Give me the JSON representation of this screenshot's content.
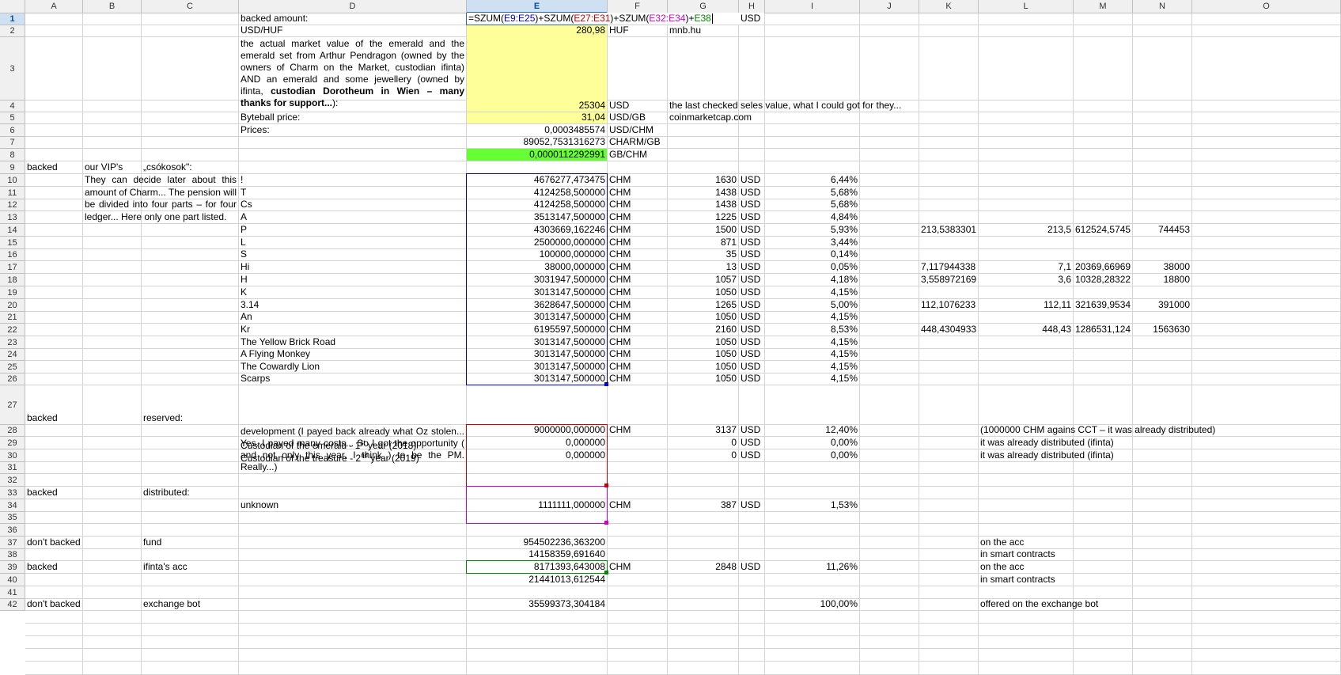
{
  "sheet": {
    "columns": [
      "A",
      "B",
      "C",
      "D",
      "E",
      "F",
      "G",
      "H",
      "I",
      "J",
      "K",
      "L",
      "M",
      "N",
      "O"
    ],
    "selected_column": "E",
    "selected_row": "1",
    "rows": [
      "1",
      "2",
      "3",
      "4",
      "5",
      "6",
      "7",
      "8",
      "9",
      "10",
      "11",
      "12",
      "13",
      "14",
      "15",
      "16",
      "17",
      "18",
      "19",
      "20",
      "21",
      "22",
      "23",
      "24",
      "25",
      "26",
      "27",
      "28",
      "29",
      "30",
      "31",
      "32",
      "33",
      "34",
      "35",
      "36",
      "37",
      "38",
      "39",
      "40",
      "41",
      "42"
    ]
  },
  "formula": {
    "p1": "=SZUM(",
    "r1": "E9:E25",
    "p2": ")+SZUM(",
    "r2": "E27:E31",
    "p3": ")+SZUM(",
    "r3": "E32:E34",
    "p4": ")+",
    "r4": "E38"
  },
  "top": {
    "backed_amount": "backed amount:",
    "usd": "USD",
    "usdhuf_label": "USD/HUF",
    "usdhuf_value": "280,98",
    "huf": "HUF",
    "mnb": "mnb.hu",
    "desc_plain": "the actual market value of the emerald and the emerald set from Arthur Pendragon (owned by the owners of Charm on the Market, custodian ifinta) AND an emerald and some jewellery (owned by ifinta, ",
    "desc_bold": "custodian Dorotheum in Wien – many thanks for support...",
    "desc_end": "):",
    "market_value": "25304",
    "market_unit": "USD",
    "seles_note": "the last checked seles value, what I could got for they...",
    "byteball_label": "Byteball price:",
    "byteball_value": "31,04",
    "byteball_unit": "USD/GB",
    "cmc": "coinmarketcap.com",
    "prices_label": "Prices:",
    "price1": "0,0003485574",
    "price1_unit": "USD/CHM",
    "price2": "89052,7531316273",
    "price2_unit": "CHARM/GB",
    "price3": "0,0000112292991",
    "price3_unit": "GB/CHM"
  },
  "r8": {
    "a": "backed",
    "b": "our VIP's",
    "c": "„csókosok\":"
  },
  "vip_note": "They can decide later about this amount of Charm... The pension will be divided into four parts – for four ledger... Here only one part listed.",
  "vip": [
    {
      "name": "!",
      "chm": "4676277,473475",
      "unit": "CHM",
      "usd": "1630",
      "cur": "USD",
      "pct": "6,44%",
      "k": "",
      "l": "",
      "m": "",
      "n": ""
    },
    {
      "name": "T",
      "chm": "4124258,500000",
      "unit": "CHM",
      "usd": "1438",
      "cur": "USD",
      "pct": "5,68%",
      "k": "",
      "l": "",
      "m": "",
      "n": ""
    },
    {
      "name": "Cs",
      "chm": "4124258,500000",
      "unit": "CHM",
      "usd": "1438",
      "cur": "USD",
      "pct": "5,68%",
      "k": "",
      "l": "",
      "m": "",
      "n": ""
    },
    {
      "name": "A",
      "chm": "3513147,500000",
      "unit": "CHM",
      "usd": "1225",
      "cur": "USD",
      "pct": "4,84%",
      "k": "",
      "l": "",
      "m": "",
      "n": ""
    },
    {
      "name": "P",
      "chm": "4303669,162246",
      "unit": "CHM",
      "usd": "1500",
      "cur": "USD",
      "pct": "5,93%",
      "k": "213,5383301",
      "l": "213,5",
      "m": "612524,5745",
      "n": "744453"
    },
    {
      "name": "L",
      "chm": "2500000,000000",
      "unit": "CHM",
      "usd": "871",
      "cur": "USD",
      "pct": "3,44%",
      "k": "",
      "l": "",
      "m": "",
      "n": ""
    },
    {
      "name": "S",
      "chm": "100000,000000",
      "unit": "CHM",
      "usd": "35",
      "cur": "USD",
      "pct": "0,14%",
      "k": "",
      "l": "",
      "m": "",
      "n": ""
    },
    {
      "name": "Hi",
      "chm": "38000,000000",
      "unit": "CHM",
      "usd": "13",
      "cur": "USD",
      "pct": "0,05%",
      "k": "7,117944338",
      "l": "7,1",
      "m": "20369,66969",
      "n": "38000"
    },
    {
      "name": "H",
      "chm": "3031947,500000",
      "unit": "CHM",
      "usd": "1057",
      "cur": "USD",
      "pct": "4,18%",
      "k": "3,558972169",
      "l": "3,6",
      "m": "10328,28322",
      "n": "18800"
    },
    {
      "name": "K",
      "chm": "3013147,500000",
      "unit": "CHM",
      "usd": "1050",
      "cur": "USD",
      "pct": "4,15%",
      "k": "",
      "l": "",
      "m": "",
      "n": ""
    },
    {
      "name": "3.14",
      "chm": "3628647,500000",
      "unit": "CHM",
      "usd": "1265",
      "cur": "USD",
      "pct": "5,00%",
      "k": "112,1076233",
      "l": "112,11",
      "m": "321639,9534",
      "n": "391000"
    },
    {
      "name": "An",
      "chm": "3013147,500000",
      "unit": "CHM",
      "usd": "1050",
      "cur": "USD",
      "pct": "4,15%",
      "k": "",
      "l": "",
      "m": "",
      "n": ""
    },
    {
      "name": "Kr",
      "chm": "6195597,500000",
      "unit": "CHM",
      "usd": "2160",
      "cur": "USD",
      "pct": "8,53%",
      "k": "448,4304933",
      "l": "448,43",
      "m": "1286531,124",
      "n": "1563630"
    },
    {
      "name": "The Yellow Brick Road",
      "chm": "3013147,500000",
      "unit": "CHM",
      "usd": "1050",
      "cur": "USD",
      "pct": "4,15%",
      "k": "",
      "l": "",
      "m": "",
      "n": ""
    },
    {
      "name": "A Flying Monkey",
      "chm": "3013147,500000",
      "unit": "CHM",
      "usd": "1050",
      "cur": "USD",
      "pct": "4,15%",
      "k": "",
      "l": "",
      "m": "",
      "n": ""
    },
    {
      "name": "The Cowardly Lion",
      "chm": "3013147,500000",
      "unit": "CHM",
      "usd": "1050",
      "cur": "USD",
      "pct": "4,15%",
      "k": "",
      "l": "",
      "m": "",
      "n": ""
    },
    {
      "name": "Scarps",
      "chm": "3013147,500000",
      "unit": "CHM",
      "usd": "1050",
      "cur": "USD",
      "pct": "4,15%",
      "k": "",
      "l": "",
      "m": "",
      "n": ""
    }
  ],
  "r26": {
    "a": "backed",
    "c": "reserved:"
  },
  "r27": {
    "d": "development (I payed back already what Oz stolen... Yes. I payed many costs... So I got the opportunity ( and not only this year, I think ) to be the PM. Really...)",
    "e": "9000000,000000",
    "f": "CHM",
    "g": "3137",
    "h": "USD",
    "i": "12,40%",
    "l": "(1000000 CHM agains CCT – it was already distributed)"
  },
  "r28": {
    "d_pre": "Custodian of the emerald - 1",
    "d_sup": "st",
    "d_post": " year (2018)",
    "e": "0,000000",
    "g": "0",
    "h": "USD",
    "i": "0,00%",
    "l": "it was already distributed (ifinta)"
  },
  "r29": {
    "d_pre": "Custodian of the treasure - 2",
    "d_sup": "nd",
    "d_post": " year (2019)",
    "e": "0,000000",
    "g": "0",
    "h": "USD",
    "i": "0,00%",
    "l": "it was already distributed (ifinta)"
  },
  "r32": {
    "a": "backed",
    "c": "distributed:"
  },
  "r33": {
    "d": "unknown",
    "e": "1111111,000000",
    "f": "CHM",
    "g": "387",
    "h": "USD",
    "i": "1,53%"
  },
  "r36": {
    "a": "don't backed",
    "c": "fund",
    "e": "954502236,363200",
    "l": "on the acc"
  },
  "r37": {
    "e": "14158359,691640",
    "l": "in smart contracts"
  },
  "r38": {
    "a": "backed",
    "c": "ifinta's acc",
    "e": "8171393,643008",
    "f": "CHM",
    "g": "2848",
    "h": "USD",
    "i": "11,26%",
    "l": "on the acc"
  },
  "r39": {
    "e": "21441013,612544",
    "l": "in smart contracts"
  },
  "r41": {
    "a": "don't backed",
    "c": "exchange bot",
    "e": "35599373,304184",
    "i": "100,00%",
    "l": "offered on the exchange bot"
  },
  "colors": {
    "range1": "#0000cc",
    "range2": "#cc0000",
    "range3": "#cc00cc",
    "range4": "#008800",
    "yellow": "#ffff99",
    "green": "#66ff33",
    "select": "#2a66c9"
  }
}
